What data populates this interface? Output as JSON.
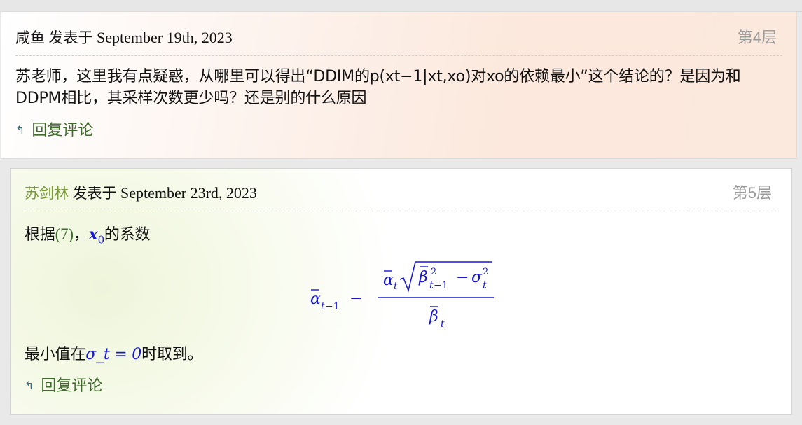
{
  "comments": [
    {
      "author": "咸鱼",
      "posted_prefix": "发表于",
      "date": "September 19th, 2023",
      "floor": "第4层",
      "text": "苏老师，这里我有点疑惑，从哪里可以得出“DDIM的p(xt−1|xt,xo)对xo的依赖最小”这个结论的？是因为和DDPM相比，其采样次数更少吗？还是别的什么原因",
      "reply_label": "回复评论",
      "reply_icon": "reply-arrow-icon"
    },
    {
      "author": "苏剑林",
      "posted_prefix": "发表于",
      "date": "September 23rd, 2023",
      "floor": "第5层",
      "text_part1": "根据",
      "ref_label": "(7)",
      "text_part2": "，",
      "math_symbol": "x",
      "math_subscript": "0",
      "text_part3": "的系数",
      "formula": "ᾱ_{t−1} − ᾱ_t √(β̄²_{t−1} − σ²_t) / β̄_t",
      "text_line2_prefix": "最小值在",
      "math_cond": "σ_t = 0",
      "text_line2_suffix": "时取到。",
      "reply_label": "回复评论",
      "reply_icon": "reply-arrow-icon"
    }
  ],
  "colors": {
    "author_highlight": "#7a9a3a",
    "reply_link": "#3f6a2b",
    "math": "#1515d6",
    "floor": "#9a9a9a"
  }
}
